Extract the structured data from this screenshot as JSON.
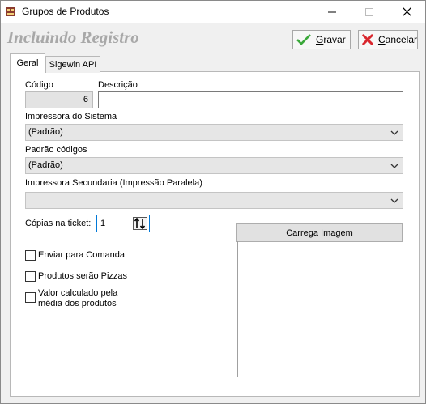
{
  "window": {
    "title": "Grupos de Produtos"
  },
  "header": {
    "title": "Incluindo Registro"
  },
  "toolbar": {
    "gravar_label": "Gravar",
    "gravar_accel": "G",
    "gravar_rest": "ravar",
    "cancelar_label": "Cancelar",
    "cancelar_accel": "C",
    "cancelar_rest": "ancelar"
  },
  "tabs": [
    {
      "label": "Geral"
    },
    {
      "label": "Sigewin API"
    }
  ],
  "form": {
    "codigo": {
      "label": "Código",
      "value": "6"
    },
    "descricao": {
      "label": "Descrição",
      "value": ""
    },
    "impressora": {
      "label": "Impressora do Sistema",
      "value": "(Padrão)"
    },
    "padrao_codigos": {
      "label": "Padrão códigos",
      "value": "(Padrão)"
    },
    "impressora_secundaria": {
      "label": "Impressora Secundaria (Impressão Paralela)",
      "value": ""
    },
    "copias": {
      "label": "Cópias na ticket:",
      "value": "1"
    },
    "checkboxes": [
      {
        "label": "Enviar para Comanda",
        "checked": false
      },
      {
        "label": "Produtos serão Pizzas",
        "checked": false
      },
      {
        "label_line1": "Valor calculado pela",
        "label_line2": "média dos produtos",
        "checked": false
      }
    ],
    "carrega_imagem_label": "Carrega Imagem"
  },
  "colors": {
    "header_title": "#a8a8a8",
    "focus_border": "#0078d7",
    "cancel_red": "#d9272e",
    "ok_green": "#3aa83a"
  },
  "icons": [
    "app-icon",
    "minimize-icon",
    "maximize-icon",
    "close-icon",
    "check-icon",
    "cancel-x-icon",
    "chevron-down-icon",
    "spin-arrows-icon"
  ]
}
